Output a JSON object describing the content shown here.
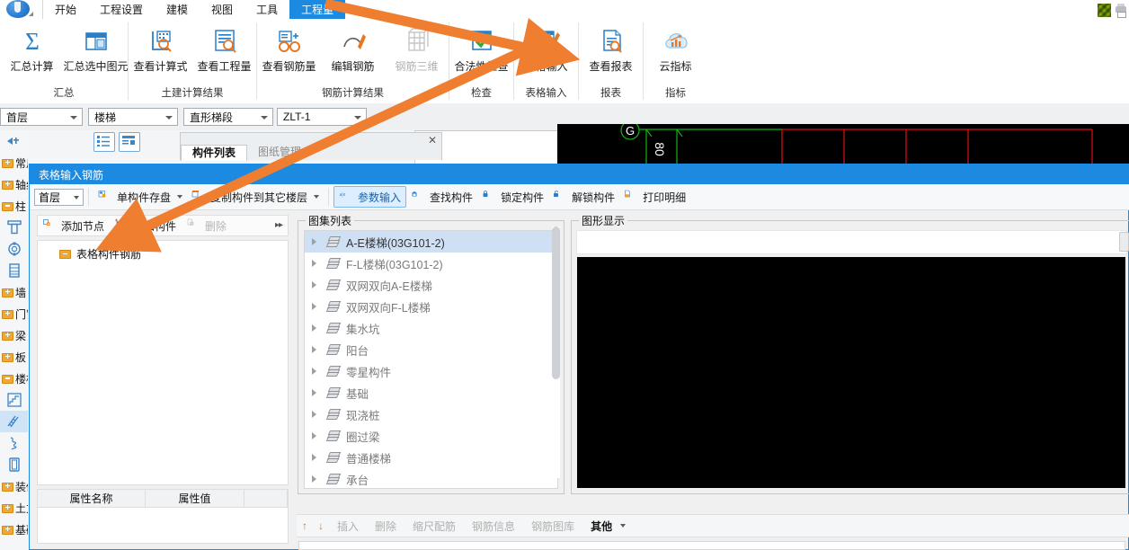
{
  "app": {
    "logo_name": "广联达-logo"
  },
  "menu": {
    "tabs": [
      {
        "label": "开始",
        "active": false
      },
      {
        "label": "工程设置",
        "active": false
      },
      {
        "label": "建模",
        "active": false
      },
      {
        "label": "视图",
        "active": false
      },
      {
        "label": "工具",
        "active": false
      },
      {
        "label": "工程量",
        "active": true
      }
    ]
  },
  "ribbon": {
    "groups": [
      {
        "name": "汇总",
        "items": [
          {
            "label": "汇总计算",
            "icon": "sigma-icon",
            "disabled": false
          },
          {
            "label": "汇总选中图元",
            "icon": "table-select-icon",
            "disabled": false
          }
        ]
      },
      {
        "name": "土建计算结果",
        "items": [
          {
            "label": "查看计算式",
            "icon": "view-formula-icon",
            "disabled": false
          },
          {
            "label": "查看工程量",
            "icon": "view-quantity-icon",
            "disabled": false
          }
        ]
      },
      {
        "name": "钢筋计算结果",
        "items": [
          {
            "label": "查看钢筋量",
            "icon": "view-rebar-icon",
            "disabled": false
          },
          {
            "label": "编辑钢筋",
            "icon": "edit-rebar-icon",
            "disabled": false
          },
          {
            "label": "钢筋三维",
            "icon": "rebar-3d-icon",
            "disabled": true
          }
        ]
      },
      {
        "name": "检查",
        "items": [
          {
            "label": "合法性检查",
            "icon": "check-valid-icon",
            "disabled": false
          }
        ]
      },
      {
        "name": "表格输入",
        "items": [
          {
            "label": "表格输入",
            "icon": "table-input-icon",
            "disabled": false
          }
        ]
      },
      {
        "name": "报表",
        "items": [
          {
            "label": "查看报表",
            "icon": "view-report-icon",
            "disabled": false
          }
        ]
      },
      {
        "name": "指标",
        "items": [
          {
            "label": "云指标",
            "icon": "cloud-indicator-icon",
            "disabled": false
          }
        ]
      }
    ]
  },
  "selectbar": {
    "floor": "首层",
    "category": "楼梯",
    "component_type": "直形梯段",
    "component_name": "ZLT-1"
  },
  "sidebar": {
    "items": [
      {
        "label": "常用",
        "type": "folder",
        "state": "closed",
        "selected": false
      },
      {
        "label": "轴线",
        "type": "folder",
        "state": "closed",
        "selected": false
      },
      {
        "label": "柱",
        "type": "folder",
        "state": "open",
        "selected": false
      },
      {
        "label": "",
        "type": "sub",
        "icon": "column-icon",
        "selected": false
      },
      {
        "label": "",
        "type": "sub",
        "icon": "structure-column-icon",
        "selected": false
      },
      {
        "label": "",
        "type": "sub",
        "icon": "brick-column-icon",
        "selected": false
      },
      {
        "label": "墙",
        "type": "folder",
        "state": "closed",
        "selected": false
      },
      {
        "label": "门窗洞",
        "type": "folder",
        "state": "closed",
        "selected": false
      },
      {
        "label": "梁",
        "type": "folder",
        "state": "closed",
        "selected": false
      },
      {
        "label": "板",
        "type": "folder",
        "state": "closed",
        "selected": false
      },
      {
        "label": "楼梯",
        "type": "folder",
        "state": "open",
        "selected": false
      },
      {
        "label": "",
        "type": "sub",
        "icon": "stair-icon",
        "selected": false
      },
      {
        "label": "",
        "type": "sub",
        "icon": "straight-stair-run-icon",
        "selected": true
      },
      {
        "label": "",
        "type": "sub",
        "icon": "spiral-stair-icon",
        "selected": false
      },
      {
        "label": "",
        "type": "sub",
        "icon": "landing-icon",
        "selected": false
      },
      {
        "label": "装修",
        "type": "folder",
        "state": "closed",
        "selected": false
      },
      {
        "label": "土方",
        "type": "folder",
        "state": "closed",
        "selected": false
      },
      {
        "label": "基础",
        "type": "folder",
        "state": "closed",
        "selected": false
      }
    ]
  },
  "component_panel": {
    "tabs": [
      {
        "label": "构件列表",
        "active": true
      },
      {
        "label": "图纸管理",
        "active": false
      }
    ],
    "close_label": "✕"
  },
  "dialog": {
    "title": "表格输入钢筋",
    "toolbar": {
      "floor": "首层",
      "buttons": [
        {
          "label": "单构件存盘",
          "icon": "save-component-icon",
          "has_caret": true,
          "highlight": false
        },
        {
          "label": "复制构件到其它楼层",
          "icon": "copy-to-floor-icon",
          "has_caret": true,
          "highlight": false
        },
        {
          "label": "参数输入",
          "icon": "param-input-icon",
          "has_caret": false,
          "highlight": true
        },
        {
          "label": "查找构件",
          "icon": "find-component-icon",
          "has_caret": false,
          "highlight": false
        },
        {
          "label": "锁定构件",
          "icon": "lock-icon",
          "has_caret": false,
          "highlight": false
        },
        {
          "label": "解锁构件",
          "icon": "unlock-icon",
          "has_caret": false,
          "highlight": false
        },
        {
          "label": "打印明细",
          "icon": "print-detail-icon",
          "has_caret": false,
          "highlight": false
        }
      ]
    },
    "tree_toolbar": {
      "buttons": [
        {
          "label": "添加节点",
          "icon": "add-node-icon",
          "disabled": false
        },
        {
          "label": "添加构件",
          "icon": "add-component-icon",
          "disabled": false
        },
        {
          "label": "删除",
          "icon": "delete-icon",
          "disabled": true
        }
      ],
      "more_label": "▸▸"
    },
    "tree": {
      "root_label": "表格构件钢筋",
      "root_icon": "folder-open-icon"
    },
    "property_table": {
      "headers": [
        "属性名称",
        "属性值"
      ],
      "rows": []
    },
    "atlas": {
      "legend": "图集列表",
      "items": [
        {
          "label": "A-E楼梯(03G101-2)",
          "selected": true
        },
        {
          "label": "F-L楼梯(03G101-2)",
          "selected": false
        },
        {
          "label": "双网双向A-E楼梯",
          "selected": false
        },
        {
          "label": "双网双向F-L楼梯",
          "selected": false
        },
        {
          "label": "集水坑",
          "selected": false
        },
        {
          "label": "阳台",
          "selected": false
        },
        {
          "label": "零星构件",
          "selected": false
        },
        {
          "label": "基础",
          "selected": false
        },
        {
          "label": "现浇桩",
          "selected": false
        },
        {
          "label": "圈过梁",
          "selected": false
        },
        {
          "label": "普通楼梯",
          "selected": false
        },
        {
          "label": "承台",
          "selected": false
        }
      ]
    },
    "graphic": {
      "legend": "图形显示"
    },
    "bottom_toolbar": {
      "up_label": "↑",
      "down_label": "↓",
      "buttons": [
        {
          "label": "插入",
          "enabled": false
        },
        {
          "label": "删除",
          "enabled": false
        },
        {
          "label": "缩尺配筋",
          "enabled": false
        },
        {
          "label": "钢筋信息",
          "enabled": false
        },
        {
          "label": "钢筋图库",
          "enabled": false
        },
        {
          "label": "其他",
          "enabled": true,
          "has_caret": true
        }
      ]
    }
  },
  "canvas": {
    "axis_label": "G",
    "dimension_label": "80",
    "grid_color": "#e01010",
    "axis_color": "#14b414",
    "background": "#000000"
  },
  "annotations": {
    "arrow_color": "#ef7e30",
    "arrow1_name": "arrow-to-table-input",
    "arrow2_name": "arrow-to-add-component"
  },
  "colors": {
    "accent": "#1c8ae0",
    "highlight": "#dceeff",
    "selected_row": "#cfe0f5",
    "orange": "#ef7e30"
  }
}
